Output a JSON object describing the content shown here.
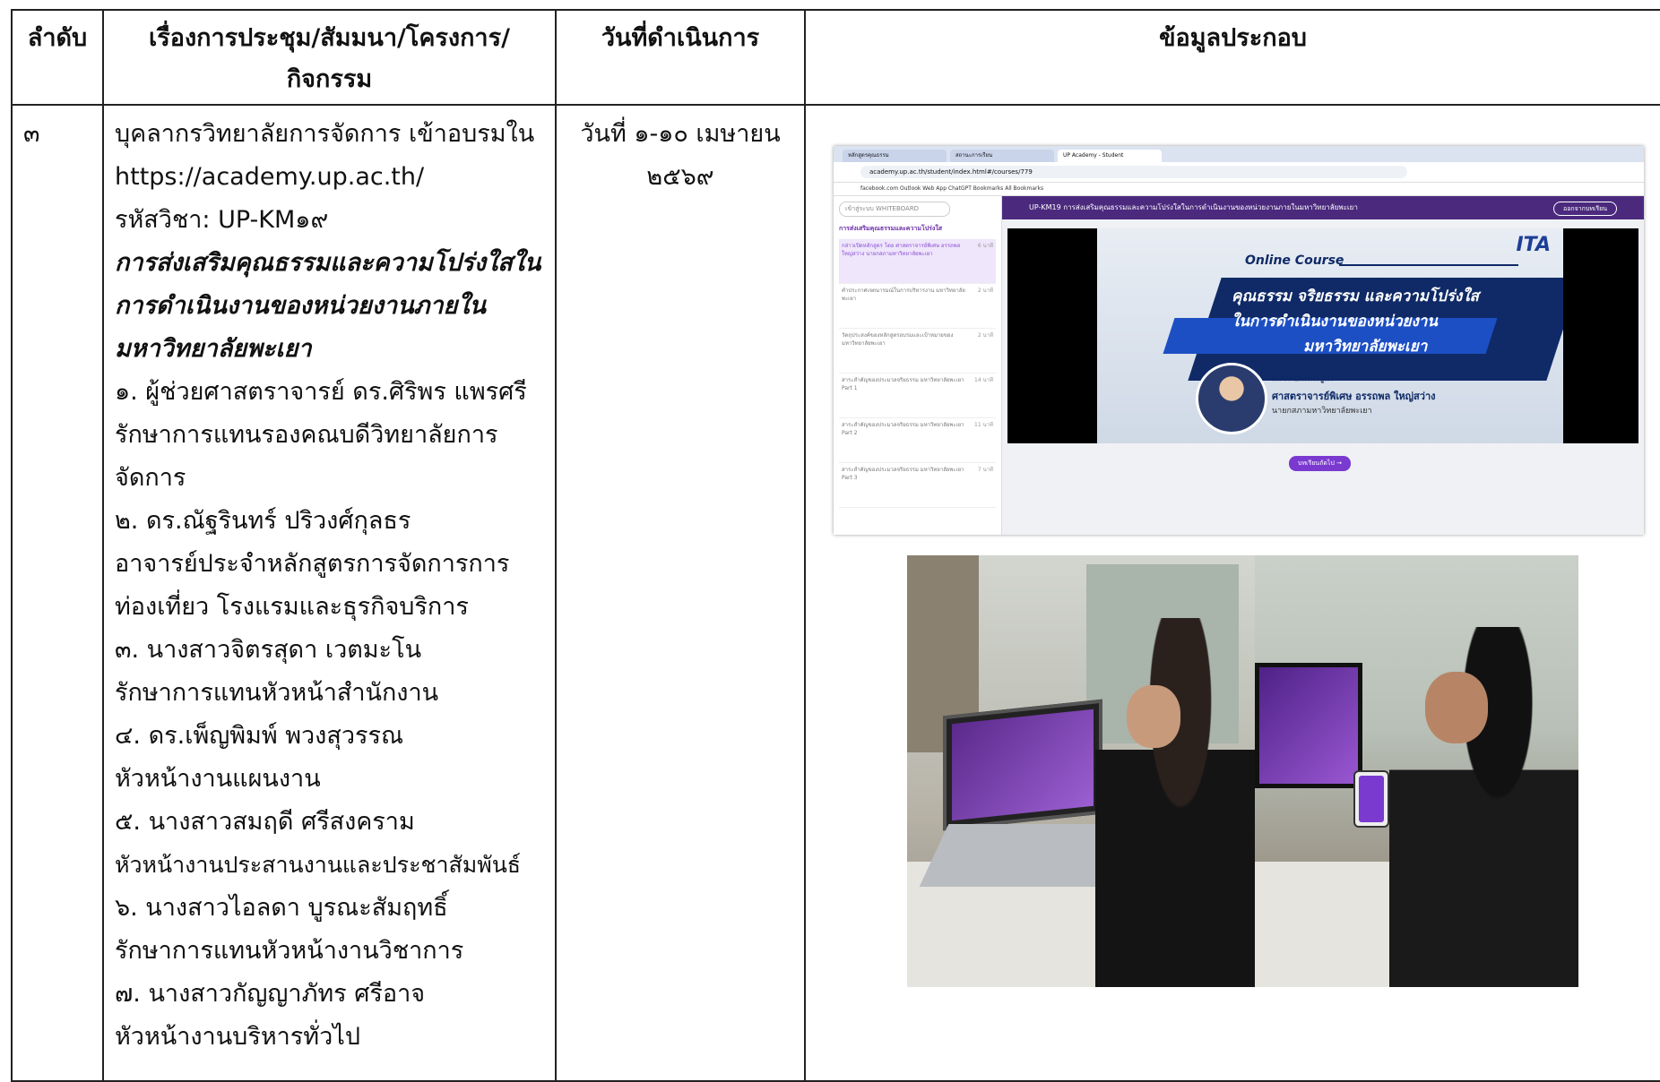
{
  "table": {
    "headers": {
      "no": "ลำดับ",
      "topic_line1": "เรื่องการประชุม/สัมมนา/โครงการ/",
      "topic_line2": "กิจกรรม",
      "date": "วันที่ดำเนินการ",
      "info": "ข้อมูลประกอบ"
    },
    "row": {
      "no": "๓",
      "lines": [
        "บุคลากรวิทยาลัยการจัดการ เข้าอบรมใน",
        "https://academy.up.ac.th/",
        "รหัสวิชา: UP-KM๑๙"
      ],
      "course_title": [
        "การส่งเสริมคุณธรรมและความโปร่งใสใน",
        "การดำเนินงานของหน่วยงานภายใน",
        "มหาวิทยาลัยพะเยา"
      ],
      "participants": [
        "๑. ผู้ช่วยศาสตราจารย์ ดร.ศิริพร แพรศรี",
        "รักษาการแทนรองคณบดีวิทยาลัยการ",
        "จัดการ",
        "๒. ดร.ณัฐรินทร์ ปริวงศ์กุลธร",
        "อาจารย์ประจำหลักสูตรการจัดการการ",
        "ท่องเที่ยว โรงแรมและธุรกิจบริการ",
        "๓. นางสาวจิตรสุดา เวตมะโน",
        "รักษาการแทนหัวหน้าสำนักงาน",
        "๔. ดร.เพ็ญพิมพ์ พวงสุวรรณ",
        "หัวหน้างานแผนงาน",
        "๕. นางสาวสมฤดี ศรีสงคราม",
        "หัวหน้างานประสานงานและประชาสัมพันธ์",
        "๖. นางสาวไอลดา บูรณะสัมฤทธิ์",
        "รักษาการแทนหัวหน้างานวิชาการ",
        "๗. นางสาวกัญญาภัทร ศรีอาจ",
        "หัวหน้างานบริหารทั่วไป"
      ],
      "date_line1": "วันที่ ๑-๑๐ เมษายน",
      "date_line2": "๒๕๖๙"
    }
  },
  "screenshot": {
    "tabs": [
      "หลักสูตรคุณธรรม",
      "สถานะการเรียน",
      "UP Academy - Student"
    ],
    "url": "academy.up.ac.th/student/index.html#/courses/779",
    "bookmarks": "facebook.com   Outlook Web App   ChatGPT   Bookmarks   All Bookmarks",
    "sidebar_pill": "เข้าสู่ระบบ WHITEBOARD",
    "sidebar_section": "การส่งเสริมคุณธรรมและความโปร่งใส",
    "sidebar_items": [
      {
        "text": "กล่าวเปิดหลักสูตร โดย ศาสตราจารย์พิเศษ อรรถพล ใหญ่สว่าง นายกสภามหาวิทยาลัยพะเยา",
        "dur": "6 นาที"
      },
      {
        "text": "คำประกาศเจตนารมณ์ในการบริหารงาน มหาวิทยาลัยพะเยา",
        "dur": "2 นาที"
      },
      {
        "text": "วัตถุประสงค์ของหลักสูตรอบรมและเป้าหมายของมหาวิทยาลัยพะเยา",
        "dur": "2 นาที"
      },
      {
        "text": "สาระสำคัญของประมวลจริยธรรม มหาวิทยาลัยพะเยา Part 1",
        "dur": "14 นาที"
      },
      {
        "text": "สาระสำคัญของประมวลจริยธรรม มหาวิทยาลัยพะเยา Part 2",
        "dur": "11 นาที"
      },
      {
        "text": "สาระสำคัญของประมวลจริยธรรม มหาวิทยาลัยพะเยา Part 3",
        "dur": "7 นาที"
      }
    ],
    "main_title": "UP-KM19 การส่งเสริมคุณธรรมและความโปร่งใสในการดำเนินงานของหน่วยงานภายในมหาวิทยาลัยพะเยา",
    "main_button": "ออกจากบทเรียน",
    "slide": {
      "online_course": "Online Course",
      "logo": "ITA",
      "title1": "คุณธรรม จริยธรรม และความโปร่งใส",
      "title2": "ในการดำเนินงานของหน่วยงาน",
      "title3": "มหาวิทยาลัยพะเยา",
      "speaker_label": "กล่าวเปิดหลักสูตร",
      "speaker_name": "ศาสตราจารย์พิเศษ อรรถพล ใหญ่สว่าง",
      "speaker_role": "นายกสภามหาวิทยาลัยพะเยา"
    },
    "next_button": "บทเรียนถัดไป →"
  }
}
